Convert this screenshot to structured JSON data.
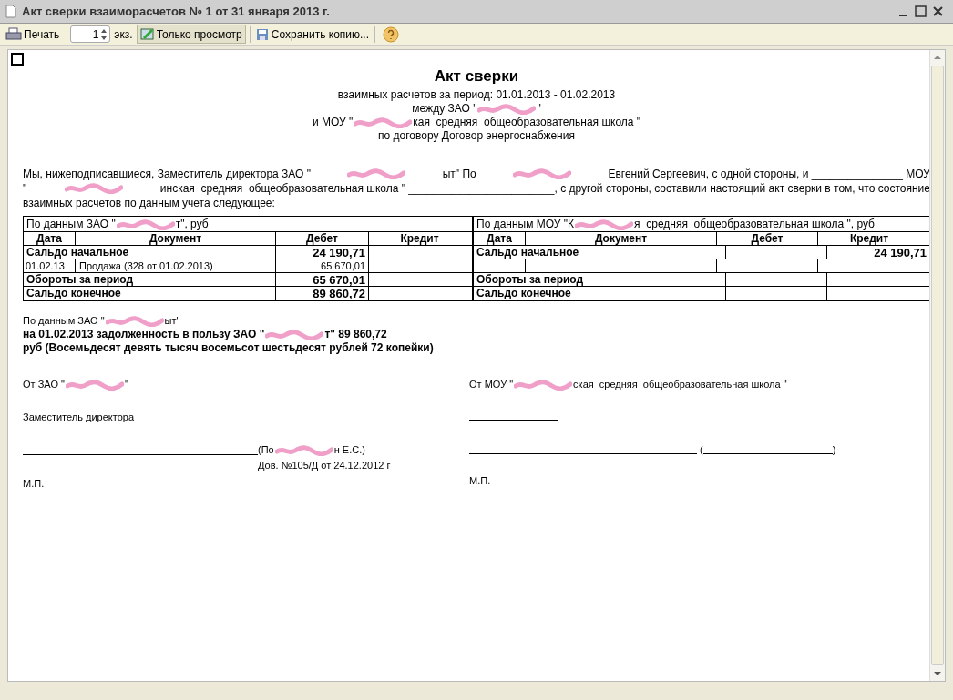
{
  "window": {
    "title": "Акт сверки взаиморасчетов № 1 от 31 января 2013 г."
  },
  "toolbar": {
    "print": "Печать",
    "copies": "1",
    "copies_unit": "экз.",
    "view_only": {
      "label": "Только просмотр",
      "selected": true
    },
    "save_copy": "Сохранить копию..."
  },
  "document": {
    "title": "Акт сверки",
    "period": "взаимных расчетов за период: 01.01.2013 - 01.02.2013",
    "between": [
      "между ЗАО \"",
      "\""
    ],
    "and_school": [
      "и МОУ \"",
      "кая  средняя  общеобразовательная школа \""
    ],
    "contract": "по договору Договор энергоснабжения",
    "intro": [
      [
        "Мы, нижеподписавшиеся, Заместитель директора ЗАО \"",
        "ыт\" По",
        "Евгений Сергеевич, с одной стороны, и _______________ МОУ"
      ],
      [
        "\"",
        "инская  средняя  общеобразовательная школа \" ________________________, с другой стороны, составили настоящий акт сверки в том, что состояние"
      ],
      [
        "взаимных расчетов по данным учета следующее:"
      ]
    ],
    "tables": [
      {
        "heading": [
          "По данным ЗАО \"",
          "т\", руб"
        ],
        "columns": [
          "Дата",
          "Документ",
          "Дебет",
          "Кредит"
        ],
        "rows": [
          {
            "kind": "total",
            "label": "Сальдо начальное",
            "debit": "24 190,71"
          },
          {
            "kind": "line",
            "date": "01.02.13",
            "document": "Продажа (328 от 01.02.2013)",
            "debit": "65 670,01"
          },
          {
            "kind": "total",
            "label": "Обороты за период",
            "debit": "65 670,01"
          },
          {
            "kind": "total",
            "label": "Сальдо конечное",
            "debit": "89 860,72"
          }
        ]
      },
      {
        "heading": [
          "По данным МОУ \"К",
          "я  средняя  общеобразовательная школа \", руб"
        ],
        "columns": [
          "Дата",
          "Документ",
          "Дебет",
          "Кредит"
        ],
        "rows": [
          {
            "kind": "total",
            "label": "Сальдо начальное",
            "credit": "24 190,71"
          },
          {
            "kind": "line"
          },
          {
            "kind": "total",
            "label": "Обороты за период"
          },
          {
            "kind": "total",
            "label": "Сальдо конечное"
          }
        ]
      }
    ],
    "summary_source": [
      "По данным ЗАО \"",
      "ыт\""
    ],
    "summary": [
      [
        "на 01.02.2013 задолженность в пользу ЗАО \"",
        "т\" 89 860,72"
      ],
      [
        "руб (Восемьдесят девять тысяч восемьсот шестьдесят рублей 72 копейки)"
      ]
    ],
    "signatures": {
      "left": {
        "party": [
          "От ЗАО \"",
          "\""
        ],
        "position": "Заместитель директора",
        "name": [
          "(По",
          "н Е.С.)"
        ],
        "authority": "Дов. №105/Д от 24.12.2012 г",
        "stamp": "М.П."
      },
      "right": {
        "party": [
          "От МОУ \"",
          "ская  средняя  общеобразовательная школа \""
        ],
        "open_paren": "(",
        "close_paren": ")",
        "stamp": "М.П."
      }
    }
  }
}
